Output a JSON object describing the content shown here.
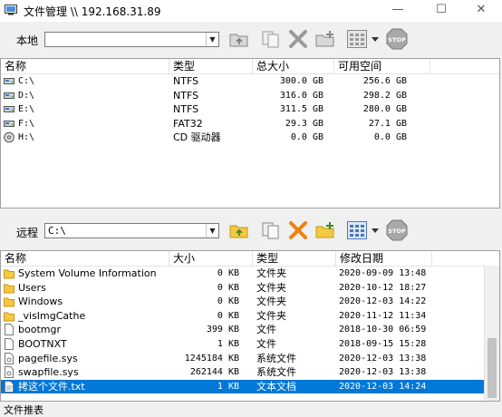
{
  "window": {
    "title": "文件管理 \\\\ 192.168.31.89",
    "minimize": "—",
    "maximize": "☐",
    "close": "✕"
  },
  "local": {
    "label": "本地",
    "path": "",
    "columns": [
      "名称",
      "类型",
      "总大小",
      "可用空间"
    ],
    "rows": [
      {
        "icon": "drive-icon",
        "name": "C:\\",
        "type": "NTFS",
        "total": "300.0 GB",
        "free": "256.6 GB"
      },
      {
        "icon": "drive-icon",
        "name": "D:\\",
        "type": "NTFS",
        "total": "316.0 GB",
        "free": "298.2 GB"
      },
      {
        "icon": "drive-icon",
        "name": "E:\\",
        "type": "NTFS",
        "total": "311.5 GB",
        "free": "280.0 GB"
      },
      {
        "icon": "drive-icon",
        "name": "F:\\",
        "type": "FAT32",
        "total": "29.3 GB",
        "free": "27.1 GB"
      },
      {
        "icon": "cd-drive-icon",
        "name": "H:\\",
        "type": "CD 驱动器",
        "total": "0.0 GB",
        "free": "0.0 GB"
      }
    ]
  },
  "remote": {
    "label": "远程",
    "path": "C:\\",
    "columns": [
      "名称",
      "大小",
      "类型",
      "修改日期"
    ],
    "rows": [
      {
        "icon": "folder-icon",
        "name": "System Volume Information",
        "size": "0 KB",
        "type": "文件夹",
        "date": "2020-09-09 13:48",
        "selected": false
      },
      {
        "icon": "folder-icon",
        "name": "Users",
        "size": "0 KB",
        "type": "文件夹",
        "date": "2020-10-12 18:27",
        "selected": false
      },
      {
        "icon": "folder-icon",
        "name": "Windows",
        "size": "0 KB",
        "type": "文件夹",
        "date": "2020-12-03 14:22",
        "selected": false
      },
      {
        "icon": "folder-icon",
        "name": "_visImgCathe",
        "size": "0 KB",
        "type": "文件夹",
        "date": "2020-11-12 11:34",
        "selected": false
      },
      {
        "icon": "file-icon",
        "name": "bootmgr",
        "size": "399 KB",
        "type": "文件",
        "date": "2018-10-30 06:59",
        "selected": false
      },
      {
        "icon": "file-icon",
        "name": "BOOTNXT",
        "size": "1 KB",
        "type": "文件",
        "date": "2018-09-15 15:28",
        "selected": false
      },
      {
        "icon": "system-file-icon",
        "name": "pagefile.sys",
        "size": "1245184 KB",
        "type": "系统文件",
        "date": "2020-12-03 13:38",
        "selected": false
      },
      {
        "icon": "system-file-icon",
        "name": "swapfile.sys",
        "size": "262144 KB",
        "type": "系统文件",
        "date": "2020-12-03 13:38",
        "selected": false
      },
      {
        "icon": "text-file-icon",
        "name": "拷这个文件.txt",
        "size": "1 KB",
        "type": "文本文档",
        "date": "2020-12-03 14:24",
        "selected": true
      }
    ]
  },
  "toolbar_icons": [
    "up-folder-icon",
    "copy-icon",
    "delete-icon",
    "new-folder-icon",
    "view-icon",
    "view-dropdown-icon",
    "stop-icon"
  ],
  "status": {
    "text": "文件推表"
  },
  "colors": {
    "selection": "#0078d7",
    "folder": "#f5c842",
    "delete": "#f08010",
    "stop": "#9e9e9e"
  }
}
